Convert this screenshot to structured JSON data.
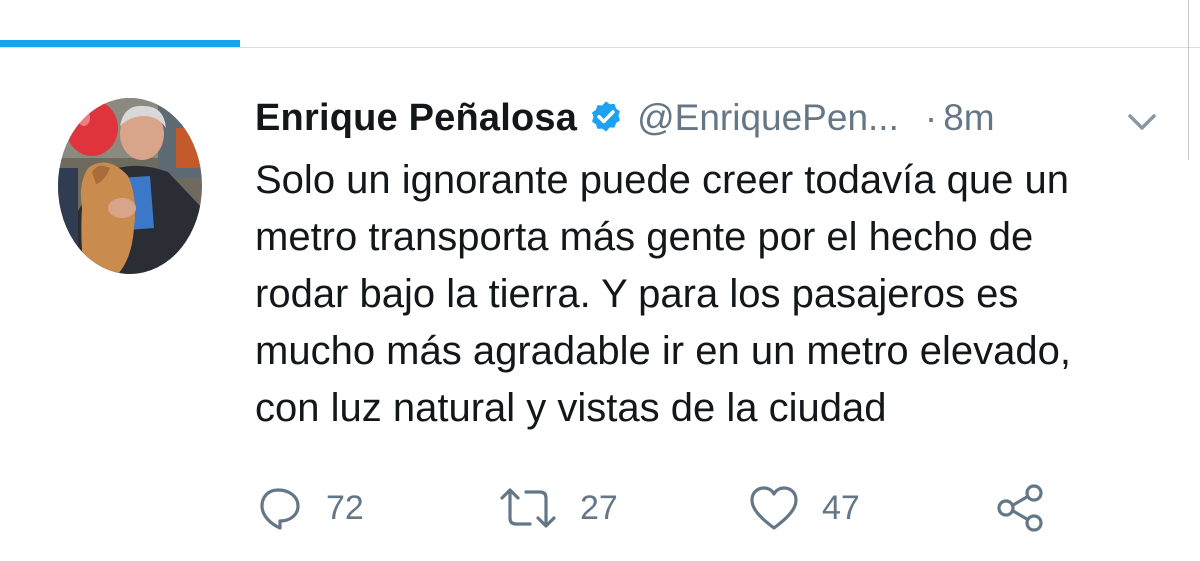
{
  "tweet": {
    "author": {
      "display_name": "Enrique Peñalosa",
      "handle": "@EnriquePen...",
      "verified": true
    },
    "separator": "·",
    "time": "8m",
    "text": "Solo un ignorante puede creer todavía que un\nmetro transporta más gente por el hecho de\nrodar bajo la tierra. Y para los pasajeros es\nmucho más agradable ir en un metro elevado,\ncon luz natural y vistas de la ciudad",
    "actions": {
      "reply_count": "72",
      "retweet_count": "27",
      "like_count": "47"
    }
  },
  "icons": {
    "verified": "verified-badge-icon",
    "menu": "chevron-down-icon",
    "reply": "reply-icon",
    "retweet": "retweet-icon",
    "like": "heart-icon",
    "share": "share-icon"
  },
  "colors": {
    "accent": "#1da1f2",
    "text": "#14171a",
    "secondary": "#657786"
  }
}
